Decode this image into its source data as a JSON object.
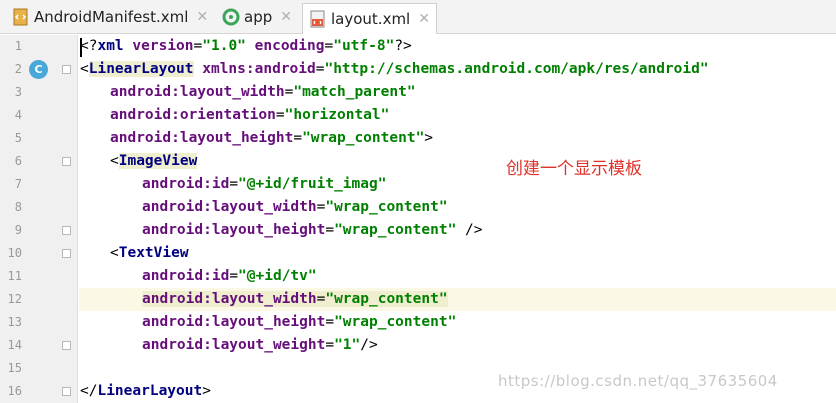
{
  "tabs": [
    {
      "label": "AndroidManifest.xml",
      "icon": "xml-file-icon",
      "selected": false
    },
    {
      "label": "app",
      "icon": "android-module-icon",
      "selected": false
    },
    {
      "label": "layout.xml",
      "icon": "layout-file-icon",
      "selected": true
    }
  ],
  "close_glyph": "✕",
  "gutter": {
    "line_numbers": [
      "1",
      "2",
      "3",
      "4",
      "5",
      "6",
      "7",
      "8",
      "9",
      "10",
      "11",
      "12",
      "13",
      "14",
      "15",
      "16"
    ],
    "class_badge": "C"
  },
  "code": {
    "l1": {
      "open": "<?",
      "tag": "xml",
      "sp1": " ",
      "a1": "version",
      "eq1": "=",
      "v1": "\"1.0\"",
      "sp2": " ",
      "a2": "encoding",
      "eq2": "=",
      "v2": "\"utf-8\"",
      "close": "?>"
    },
    "l2": {
      "open": "<",
      "tag": "LinearLayout",
      "sp": " ",
      "ns": "xmlns:",
      "attr": "android",
      "eq": "=",
      "val": "\"http://schemas.android.com/apk/res/android\""
    },
    "l3": {
      "ns": "android:",
      "attr": "layout_width",
      "eq": "=",
      "val": "\"match_parent\""
    },
    "l4": {
      "ns": "android:",
      "attr": "orientation",
      "eq": "=",
      "val": "\"horizontal\""
    },
    "l5": {
      "ns": "android:",
      "attr": "layout_height",
      "eq": "=",
      "val": "\"wrap_content\"",
      "close": ">"
    },
    "l6": {
      "open": "<",
      "tag": "ImageView"
    },
    "l7": {
      "ns": "android:",
      "attr": "id",
      "eq": "=",
      "val": "\"@+id/fruit_imag\""
    },
    "l8": {
      "ns": "android:",
      "attr": "layout_width",
      "eq": "=",
      "val": "\"wrap_content\""
    },
    "l9": {
      "ns": "android:",
      "attr": "layout_height",
      "eq": "=",
      "val": "\"wrap_content\"",
      "close": " />"
    },
    "l10": {
      "open": "<",
      "tag": "TextView"
    },
    "l11": {
      "ns": "android:",
      "attr": "id",
      "eq": "=",
      "val": "\"@+id/tv\""
    },
    "l12": {
      "ns": "android:",
      "attr": "layout_width",
      "eq": "=",
      "val": "\"wrap_content\""
    },
    "l13": {
      "ns": "android:",
      "attr": "layout_height",
      "eq": "=",
      "val": "\"wrap_content\""
    },
    "l14": {
      "ns": "android:",
      "attr": "layout_weight",
      "eq": "=",
      "val": "\"1\"",
      "close": "/>"
    },
    "l16": {
      "open": "</",
      "tag": "LinearLayout",
      "close": ">"
    }
  },
  "annotation": "创建一个显示模板",
  "watermark": "https://blog.csdn.net/qq_37635604",
  "colors": {
    "tag": "#000080",
    "attr": "#660e7a",
    "value": "#008000",
    "annotation": "#e0302a"
  }
}
